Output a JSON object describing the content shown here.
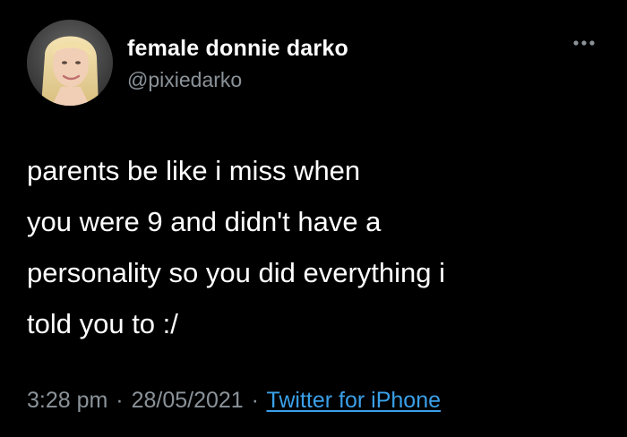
{
  "tweet": {
    "author": {
      "display_name": "female donnie darko",
      "handle": "@pixiedarko",
      "avatar_icon": "profile-photo-avatar"
    },
    "more_icon": "more-options-icon",
    "text_lines": [
      "parents be like  i miss when",
      "you were 9 and didn't have a",
      "personality so you did everything i",
      "told you to :/"
    ],
    "meta": {
      "time": "3:28 pm",
      "separator": "·",
      "date": "28/05/2021",
      "source": "Twitter for iPhone"
    }
  },
  "colors": {
    "background": "#000000",
    "primary_text": "#ffffff",
    "secondary_text": "#8b9399",
    "link": "#3aa0e8"
  }
}
